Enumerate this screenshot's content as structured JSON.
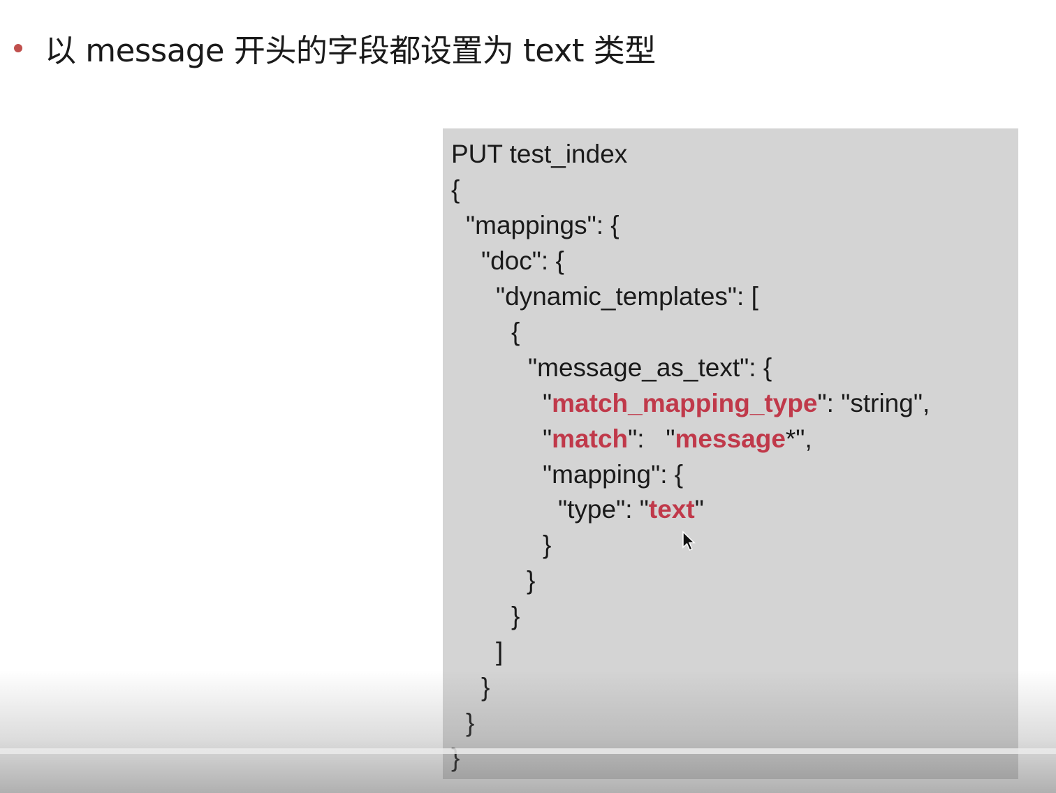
{
  "slide": {
    "bullet_text": "以 message 开头的字段都设置为 text 类型",
    "bullet_color": "#c0504d"
  },
  "code": {
    "background": "#d4d4d4",
    "highlight_color": "#c0394a",
    "line_1": "PUT test_index",
    "line_2": "{",
    "line_3": "\"mappings\": {",
    "line_4": "\"doc\": {",
    "line_5": "\"dynamic_templates\": [",
    "line_6": "{",
    "line_7": "\"message_as_text\": {",
    "line_8_q1": "\"",
    "line_8_kw": "match_mapping_type",
    "line_8_rest": "\": \"string\",",
    "line_9_q1": "\"",
    "line_9_kw": "match",
    "line_9_mid": "\":   \"",
    "line_9_kw2": "message",
    "line_9_rest": "*\",",
    "line_10": "\"mapping\": {",
    "line_11_pre": "\"type\": \"",
    "line_11_kw": "text",
    "line_11_post": "\"",
    "line_12": "}",
    "line_13": "}",
    "line_14": "}",
    "line_15": "]",
    "line_16": "}",
    "line_17": "}",
    "line_18": "}"
  },
  "icons": {
    "cursor": "mouse-pointer-icon"
  }
}
